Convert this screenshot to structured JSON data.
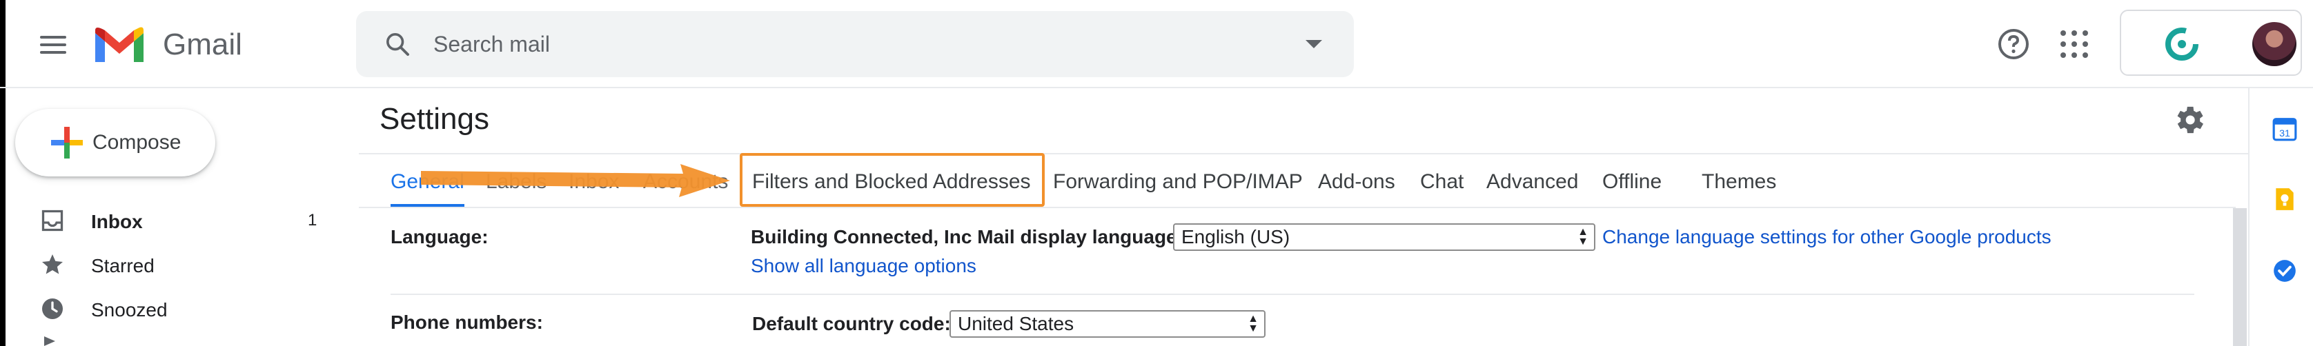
{
  "header": {
    "app_name": "Gmail",
    "search_placeholder": "Search mail"
  },
  "sidebar": {
    "compose_label": "Compose",
    "items": [
      {
        "label": "Inbox",
        "count": "1",
        "bold": true
      },
      {
        "label": "Starred",
        "count": ""
      },
      {
        "label": "Snoozed",
        "count": ""
      }
    ]
  },
  "settings": {
    "title": "Settings",
    "tabs": [
      {
        "label": "General",
        "active": true
      },
      {
        "label": "Labels"
      },
      {
        "label": "Inbox"
      },
      {
        "label": "Accounts"
      },
      {
        "label": "Filters and Blocked Addresses",
        "highlighted": true
      },
      {
        "label": "Forwarding and POP/IMAP"
      },
      {
        "label": "Add-ons"
      },
      {
        "label": "Chat"
      },
      {
        "label": "Advanced"
      },
      {
        "label": "Offline"
      },
      {
        "label": "Themes"
      }
    ],
    "rows": {
      "language": {
        "label": "Language:",
        "description": "Building Connected, Inc Mail display language:",
        "selected": "English (US)",
        "change_link": "Change language settings for other Google products",
        "show_all_link": "Show all language options"
      },
      "phone": {
        "label": "Phone numbers:",
        "description": "Default country code:",
        "selected": "United States"
      }
    }
  },
  "colors": {
    "accent": "#1a73e8",
    "highlight": "#f2912c",
    "link": "#1155cc"
  },
  "icons": {
    "menu": "menu-icon",
    "search": "search-icon",
    "dropdown": "chevron-down-icon",
    "help": "help-icon",
    "apps": "apps-grid-icon",
    "settings": "gear-icon",
    "calendar": "calendar-icon",
    "keep": "keep-icon",
    "tasks": "tasks-icon"
  }
}
